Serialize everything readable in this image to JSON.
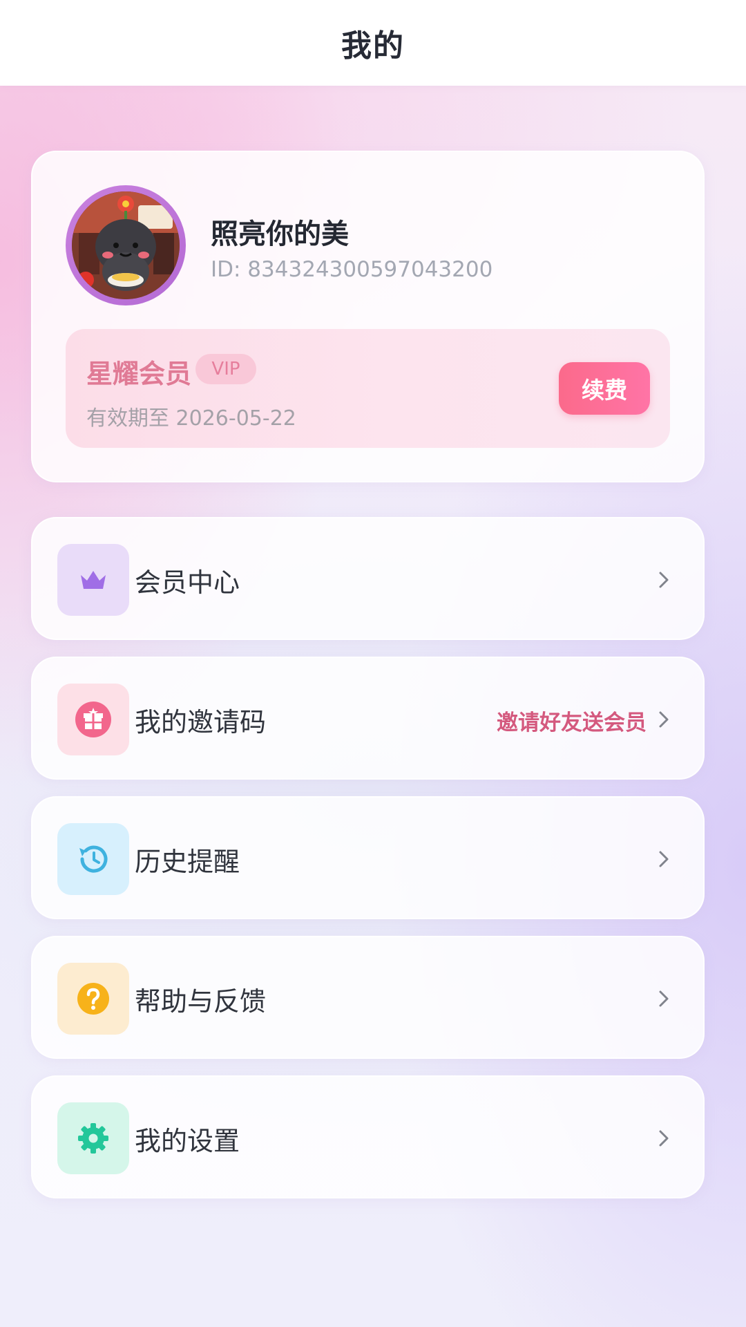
{
  "header": {
    "title": "我的"
  },
  "profile": {
    "username": "照亮你的美",
    "user_id": "ID: 834324300597043200",
    "avatar_icon": "avatar-image"
  },
  "vip": {
    "title": "星耀会员",
    "badge": "VIP",
    "expiry": "有效期至 2026-05-22",
    "renew_label": "续费"
  },
  "menu": [
    {
      "label": "会员中心",
      "icon": "crown-icon",
      "icon_bg": "#e9dcf9",
      "icon_color": "#a06ee6"
    },
    {
      "label": "我的邀请码",
      "icon": "gift-icon",
      "icon_bg": "#fde0e7",
      "icon_color": "#f2668c",
      "extra": "邀请好友送会员"
    },
    {
      "label": "历史提醒",
      "icon": "history-icon",
      "icon_bg": "#d7f0fd",
      "icon_color": "#3fb2df"
    },
    {
      "label": "帮助与反馈",
      "icon": "help-icon",
      "icon_bg": "#fdecd0",
      "icon_color": "#f7b21a"
    },
    {
      "label": "我的设置",
      "icon": "gear-icon",
      "icon_bg": "#d5f6ea",
      "icon_color": "#23c79a"
    }
  ],
  "colors": {
    "accent_pink": "#fb6a8b",
    "vip_text": "#e07a95",
    "invite_text": "#d4597e"
  }
}
